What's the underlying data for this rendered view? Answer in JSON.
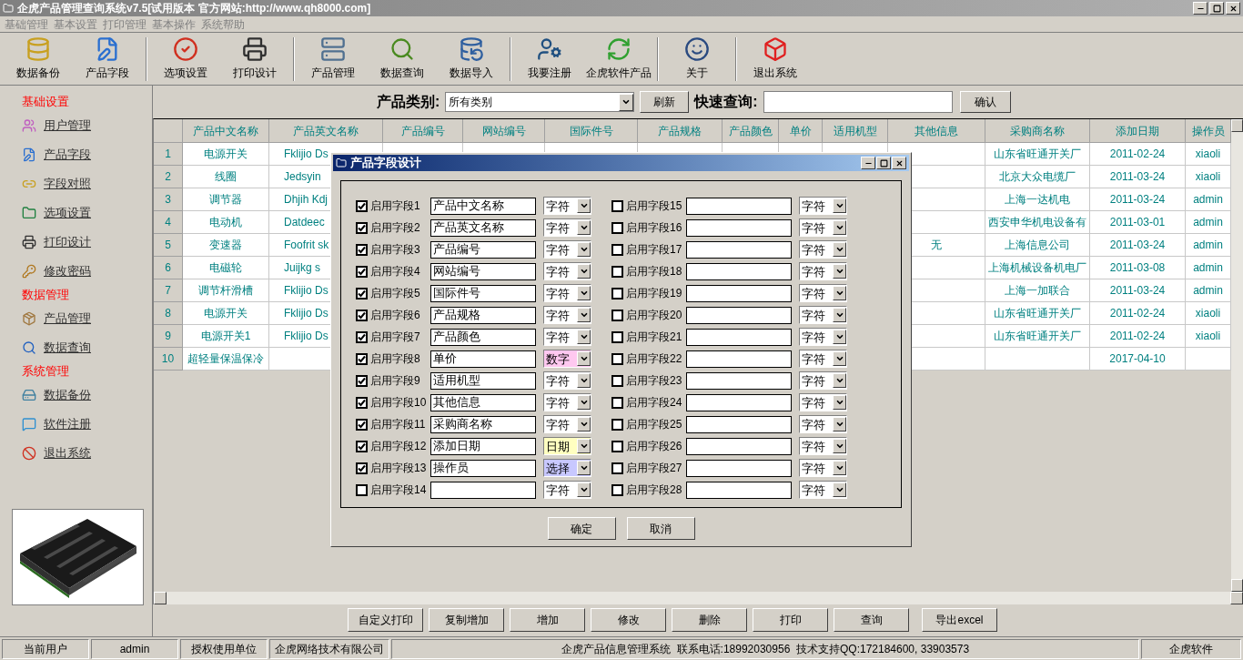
{
  "window": {
    "title": "企虎产品管理查询系统v7.5[试用版本 官方网站:http://www.qh8000.com]"
  },
  "menu": [
    "基础管理",
    "基本设置",
    "打印管理",
    "基本操作",
    "系统帮助"
  ],
  "toolbar_groups": [
    {
      "buttons": [
        "数据备份",
        "产品字段"
      ]
    },
    {
      "buttons": [
        "选项设置",
        "打印设计"
      ]
    },
    {
      "buttons": [
        "产品管理",
        "数据查询",
        "数据导入"
      ]
    },
    {
      "buttons": [
        "我要注册",
        "企虎软件产品"
      ]
    },
    {
      "buttons": [
        "关于"
      ]
    },
    {
      "buttons": [
        "退出系统"
      ]
    }
  ],
  "sidebar": {
    "sections": [
      {
        "title": "基础设置",
        "items": [
          "用户管理",
          "产品字段",
          "字段对照",
          "选项设置",
          "打印设计",
          "修改密码"
        ]
      },
      {
        "title": "数据管理",
        "items": [
          "产品管理",
          "数据查询"
        ]
      },
      {
        "title": "系统管理",
        "items": [
          "数据备份",
          "软件注册",
          "退出系统"
        ]
      }
    ]
  },
  "filter": {
    "category_label": "产品类别:",
    "category_value": "所有类别",
    "refresh_button": "刷新",
    "quick_search_label": "快速查询:",
    "confirm_button": "确认"
  },
  "table": {
    "columns": [
      "产品中文名称",
      "产品英文名称",
      "产品编号",
      "网站编号",
      "国际件号",
      "产品规格",
      "产品颜色",
      "单价",
      "适用机型",
      "其他信息",
      "采购商名称",
      "添加日期",
      "操作员"
    ],
    "rows": [
      {
        "number": "1",
        "chinese_name": "电源开关",
        "english_name": "Fklijio Ds",
        "buyer": "山东省旺通开关厂",
        "date": "2011-02-24",
        "operator": "xiaoli"
      },
      {
        "number": "2",
        "chinese_name": "线圈",
        "english_name": "Jedsyin",
        "buyer": "北京大众电缆厂",
        "date": "2011-03-24",
        "operator": "xiaoli"
      },
      {
        "number": "3",
        "chinese_name": "调节器",
        "english_name": "Dhjih Kdj",
        "buyer": "上海一达机电",
        "date": "2011-03-24",
        "operator": "admin"
      },
      {
        "number": "4",
        "chinese_name": "电动机",
        "english_name": "Datdeec",
        "buyer": "西安申华机电设备有",
        "date": "2011-03-01",
        "operator": "admin"
      },
      {
        "number": "5",
        "chinese_name": "变速器",
        "english_name": "Foofrit sk",
        "other_info": "无",
        "buyer": "上海信息公司",
        "date": "2011-03-24",
        "operator": "admin"
      },
      {
        "number": "6",
        "chinese_name": "电磁轮",
        "english_name": "Juijkg s",
        "buyer": "上海机械设备机电厂",
        "date": "2011-03-08",
        "operator": "admin"
      },
      {
        "number": "7",
        "chinese_name": "调节杆滑槽",
        "english_name": "Fklijio Ds",
        "buyer": "上海一加联合",
        "date": "2011-03-24",
        "operator": "admin"
      },
      {
        "number": "8",
        "chinese_name": "电源开关",
        "english_name": "Fklijio Ds",
        "buyer": "山东省旺通开关厂",
        "date": "2011-02-24",
        "operator": "xiaoli"
      },
      {
        "number": "9",
        "chinese_name": "电源开关1",
        "english_name": "Fklijio Ds",
        "buyer": "山东省旺通开关厂",
        "date": "2011-02-24",
        "operator": "xiaoli"
      },
      {
        "number": "10",
        "chinese_name": "超轻量保温保冷",
        "date": "2017-04-10"
      }
    ]
  },
  "actions": [
    "自定义打印",
    "复制增加",
    "增加",
    "修改",
    "删除",
    "打印",
    "查询",
    "导出excel"
  ],
  "status_bar": [
    "当前用户",
    "admin",
    "授权使用单位",
    "企虎网络技术有限公司",
    "企虎产品信息管理系统  联系电话:18992030956  技术支持QQ:172184600, 33903573",
    "企虎软件"
  ],
  "dialog": {
    "title": "产品字段设计",
    "fields": [
      {
        "label": "启用字段1",
        "enabled": true,
        "value": "产品中文名称",
        "type": "字符",
        "color": "#ffffff"
      },
      {
        "label": "启用字段2",
        "enabled": true,
        "value": "产品英文名称",
        "type": "字符",
        "color": "#ffffff"
      },
      {
        "label": "启用字段3",
        "enabled": true,
        "value": "产品编号",
        "type": "字符",
        "color": "#ffffff"
      },
      {
        "label": "启用字段4",
        "enabled": true,
        "value": "网站编号",
        "type": "字符",
        "color": "#ffffff"
      },
      {
        "label": "启用字段5",
        "enabled": true,
        "value": "国际件号",
        "type": "字符",
        "color": "#ffffff"
      },
      {
        "label": "启用字段6",
        "enabled": true,
        "value": "产品规格",
        "type": "字符",
        "color": "#ffffff"
      },
      {
        "label": "启用字段7",
        "enabled": true,
        "value": "产品颜色",
        "type": "字符",
        "color": "#ffffff"
      },
      {
        "label": "启用字段8",
        "enabled": true,
        "value": "单价",
        "type": "数字",
        "color": "#ffc8f0"
      },
      {
        "label": "启用字段9",
        "enabled": true,
        "value": "适用机型",
        "type": "字符",
        "color": "#ffffff"
      },
      {
        "label": "启用字段10",
        "enabled": true,
        "value": "其他信息",
        "type": "字符",
        "color": "#ffffff"
      },
      {
        "label": "启用字段11",
        "enabled": true,
        "value": "采购商名称",
        "type": "字符",
        "color": "#ffffff"
      },
      {
        "label": "启用字段12",
        "enabled": true,
        "value": "添加日期",
        "type": "日期",
        "color": "#ffffc0"
      },
      {
        "label": "启用字段13",
        "enabled": true,
        "value": "操作员",
        "type": "选择",
        "color": "#c8c8ff"
      },
      {
        "label": "启用字段14",
        "enabled": false,
        "type": "字符",
        "color": "#ffffff"
      },
      {
        "label": "启用字段15",
        "enabled": false,
        "type": "字符",
        "color": "#ffffff"
      },
      {
        "label": "启用字段16",
        "enabled": false,
        "type": "字符",
        "color": "#ffffff"
      },
      {
        "label": "启用字段17",
        "enabled": false,
        "type": "字符",
        "color": "#ffffff"
      },
      {
        "label": "启用字段18",
        "enabled": false,
        "type": "字符",
        "color": "#ffffff"
      },
      {
        "label": "启用字段19",
        "enabled": false,
        "type": "字符",
        "color": "#ffffff"
      },
      {
        "label": "启用字段20",
        "enabled": false,
        "type": "字符",
        "color": "#ffffff"
      },
      {
        "label": "启用字段21",
        "enabled": false,
        "type": "字符",
        "color": "#ffffff"
      },
      {
        "label": "启用字段22",
        "enabled": false,
        "type": "字符",
        "color": "#ffffff"
      },
      {
        "label": "启用字段23",
        "enabled": false,
        "type": "字符",
        "color": "#ffffff"
      },
      {
        "label": "启用字段24",
        "enabled": false,
        "type": "字符",
        "color": "#ffffff"
      },
      {
        "label": "启用字段25",
        "enabled": false,
        "type": "字符",
        "color": "#ffffff"
      },
      {
        "label": "启用字段26",
        "enabled": false,
        "type": "字符",
        "color": "#ffffff"
      },
      {
        "label": "启用字段27",
        "enabled": false,
        "type": "字符",
        "color": "#ffffff"
      },
      {
        "label": "启用字段28",
        "enabled": false,
        "type": "字符",
        "color": "#ffffff"
      }
    ],
    "buttons": [
      "确定",
      "取消"
    ]
  }
}
